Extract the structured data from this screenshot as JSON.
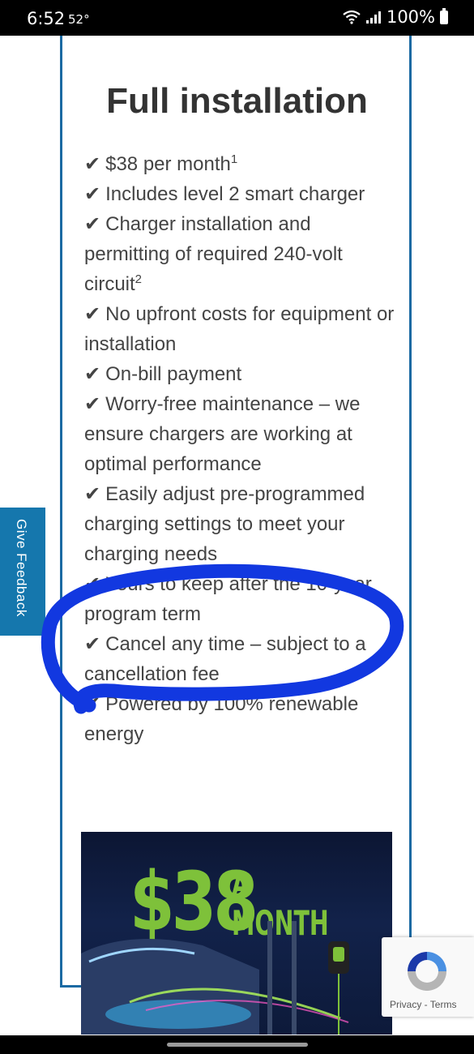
{
  "status": {
    "time": "6:52",
    "temp": "52°",
    "battery": "100%",
    "icons": [
      "wifi-icon",
      "signal-icon",
      "battery-icon"
    ]
  },
  "card": {
    "title": "Full installation",
    "items": [
      {
        "text": "$38 per month",
        "sup": "1"
      },
      {
        "text": "Includes level 2 smart charger",
        "sup": ""
      },
      {
        "text": "Charger installation and permitting of required 240-volt circuit",
        "sup": "2"
      },
      {
        "text": "No upfront costs for equipment or installation",
        "sup": ""
      },
      {
        "text": "On-bill payment",
        "sup": ""
      },
      {
        "text": "Worry-free maintenance – we ensure chargers are working at optimal performance",
        "sup": ""
      },
      {
        "text": "Easily adjust pre-programmed charging settings to meet your charging needs",
        "sup": ""
      },
      {
        "text": "Yours to keep after the 10-year program term",
        "sup": ""
      },
      {
        "text": "Cancel any time – subject to a cancellation fee",
        "sup": ""
      },
      {
        "text": "Powered by 100% renewable energy",
        "sup": ""
      }
    ],
    "check_glyph": "✔"
  },
  "promo": {
    "amount": "$38",
    "suffix": "A MONTH"
  },
  "feedback": {
    "label": "Give Feedback"
  },
  "recaptcha": {
    "links": "Privacy - Terms"
  },
  "colors": {
    "frame": "#1b6aa3",
    "feedback_bg": "#1577ad",
    "scribble": "#1238e0",
    "promo_green": "#7ec13a"
  }
}
